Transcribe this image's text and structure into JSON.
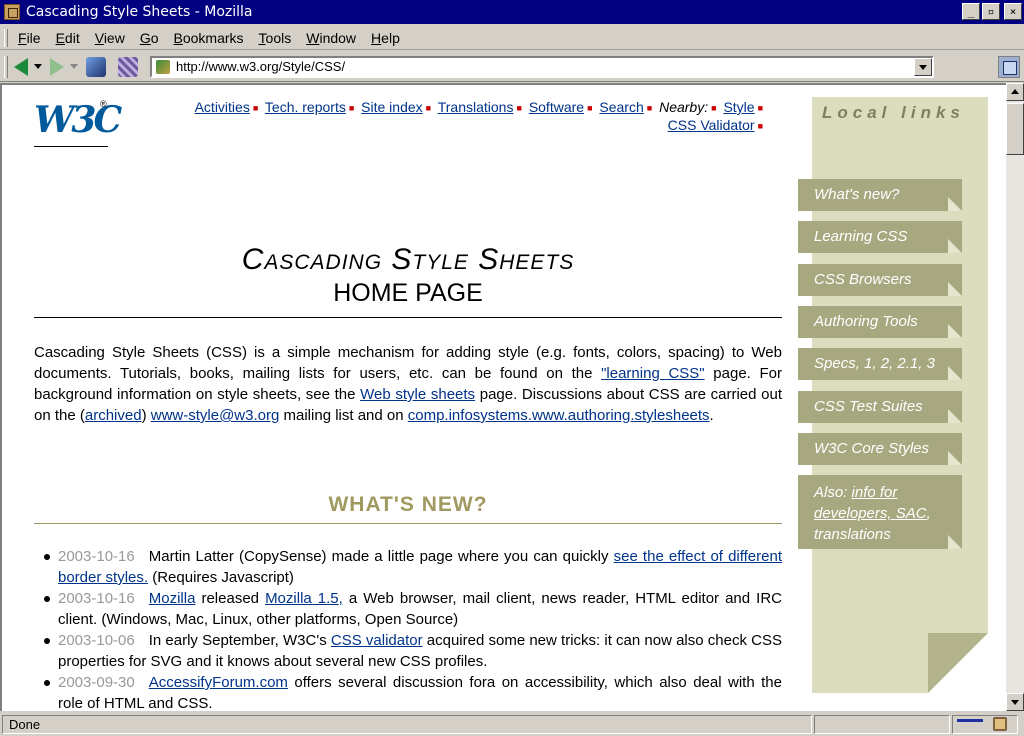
{
  "window": {
    "title": "Cascading Style Sheets - Mozilla"
  },
  "menu": {
    "items": [
      {
        "key": "F",
        "rest": "ile"
      },
      {
        "key": "E",
        "rest": "dit"
      },
      {
        "key": "V",
        "rest": "iew"
      },
      {
        "key": "G",
        "rest": "o"
      },
      {
        "key": "B",
        "rest": "ookmarks"
      },
      {
        "key": "T",
        "rest": "ools"
      },
      {
        "key": "W",
        "rest": "indow"
      },
      {
        "key": "H",
        "rest": "elp"
      }
    ]
  },
  "nav": {
    "url": "http://www.w3.org/Style/CSS/"
  },
  "page": {
    "logo": "W3C",
    "logo_mark": "®",
    "topnav": {
      "activities": "Activities",
      "tech_reports": "Tech. reports",
      "site_index": "Site index",
      "translations": "Translations",
      "software": "Software",
      "search": "Search",
      "nearby": "Nearby:",
      "style": "Style",
      "css_validator": "CSS Validator"
    },
    "title_line1": "Cascading Style Sheets",
    "title_line2": "HOME PAGE",
    "intro": {
      "t1": "Cascading Style Sheets (CSS) is a simple mechanism for adding style (e.g. fonts, colors, spacing) to Web documents. Tutorials, books, mailing lists for users, etc. can be found on the ",
      "l1": "\"learning CSS\"",
      "t2": " page. For background information on style sheets, see the ",
      "l2": "Web style sheets",
      "t3": " page. Discussions about CSS are carried out on the (",
      "l3": "archived",
      "t4": ") ",
      "l4": "www-style@w3.org",
      "t5": " mailing list and on ",
      "l5": "comp.infosystems.www.authoring.stylesheets",
      "t6": "."
    },
    "whats_new_heading": "WHAT'S NEW?",
    "news": [
      {
        "date": "2003-10-16",
        "t1": "Martin Latter (CopySense) made a little page where you can quickly ",
        "l1": "see the effect of different border styles.",
        "t2": " (Requires Javascript)"
      },
      {
        "date": "2003-10-16",
        "l0": "Mozilla",
        "t1": " released ",
        "l1": "Mozilla 1.5,",
        "t2": " a Web browser, mail client, news reader, HTML editor and IRC client. (Windows, Mac, Linux, other platforms, Open Source)"
      },
      {
        "date": "2003-10-06",
        "t1": "In early September, W3C's ",
        "l1": "CSS validator",
        "t2": " acquired some new tricks: it can now also check CSS properties for SVG and it knows about several new CSS profiles."
      },
      {
        "date": "2003-09-30",
        "l0": "AccessifyForum.com",
        "t1": " offers several discussion fora on accessibility, which also deal with the role of HTML and CSS."
      }
    ]
  },
  "sidebar": {
    "title": "Local links",
    "links": [
      "What's new?",
      "Learning CSS",
      "CSS Browsers",
      "Authoring Tools",
      "Specs, 1, 2, 2.1, 3",
      "CSS Test Suites",
      "W3C Core Styles"
    ],
    "also": {
      "prefix": "Also: ",
      "t1": "info for developers, ",
      "sac": "SAC",
      "t2": ", translations"
    }
  },
  "status": {
    "text": "Done"
  },
  "colors": {
    "accent": "#a09a60",
    "link": "#00338a",
    "sidebar_bg": "#dcdcbe",
    "sidebar_tab": "#a8a880"
  }
}
